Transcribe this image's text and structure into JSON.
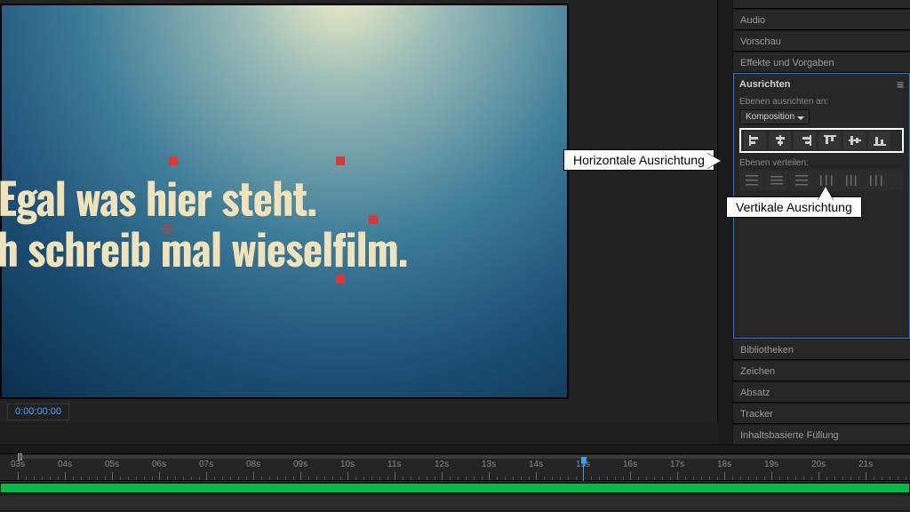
{
  "viewer": {
    "text_line1": "  Egal was hier steht.",
    "text_line2": "ch schreib mal wieselfilm.",
    "timecode": "0:00:00:00"
  },
  "annotations": {
    "horizontal": "Horizontale Ausrichtung",
    "vertical": "Vertikale Ausrichtung"
  },
  "panels": {
    "audio": "Audio",
    "preview": "Vorschau",
    "effects": "Effekte und Vorgaben",
    "libs": "Bibliotheken",
    "char": "Zeichen",
    "para": "Absatz",
    "tracker": "Tracker",
    "fill": "Inhaltsbasierte Füllung"
  },
  "align": {
    "title": "Ausrichten",
    "label_alignto": "Ebenen ausrichten an:",
    "target": "Komposition",
    "label_distribute": "Ebenen verteilen:",
    "btn_h_left": "align-left",
    "btn_h_center": "align-h-center",
    "btn_h_right": "align-right",
    "btn_v_top": "align-top",
    "btn_v_center": "align-v-center",
    "btn_v_bottom": "align-bottom"
  },
  "timeline": {
    "ticks": [
      "03s",
      "04s",
      "05s",
      "06s",
      "07s",
      "08s",
      "09s",
      "10s",
      "11s",
      "12s",
      "13s",
      "14s",
      "15s",
      "16s",
      "17s",
      "18s",
      "19s",
      "20s",
      "21s"
    ],
    "playhead_sec": 15
  }
}
